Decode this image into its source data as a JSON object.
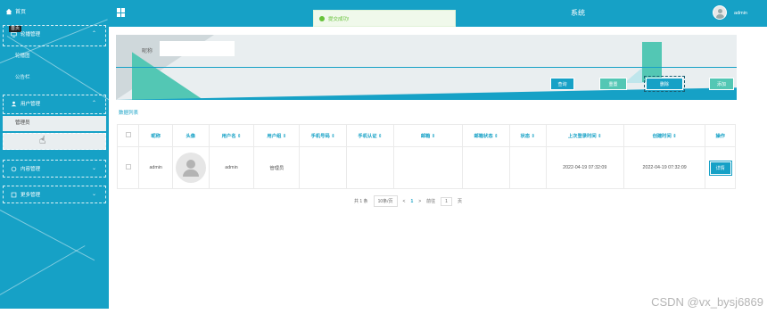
{
  "sidebar": {
    "home_label": "首页",
    "tooltip": "首页",
    "groups": [
      {
        "label": "轮播管理",
        "items": [
          "轮播图",
          "公告栏"
        ]
      },
      {
        "label": "用户管理",
        "items": [
          "管理员"
        ]
      },
      {
        "label": "内容管理",
        "items": []
      },
      {
        "label": "更多管理",
        "items": []
      }
    ]
  },
  "topbar": {
    "title_fragment": "系统",
    "user": "admin"
  },
  "toast": {
    "message": "提交成功!"
  },
  "search": {
    "label": "昵称",
    "value": ""
  },
  "toolbar": {
    "query_label": "查询",
    "reset_label": "重置",
    "delete_label": "删除",
    "add_label": "添加"
  },
  "table": {
    "title": "数据列表",
    "columns": [
      "昵称",
      "头像",
      "用户名 ⇕",
      "用户组 ⇕",
      "手机号码 ⇕",
      "手机认证 ⇕",
      "邮箱 ⇕",
      "邮箱状态 ⇕",
      "状态 ⇕",
      "上次登录时间 ⇕",
      "创建时间 ⇕",
      "操作"
    ],
    "rows": [
      {
        "nickname": "admin",
        "username": "admin",
        "group": "管理员",
        "phone": "",
        "phone_verified": "",
        "email": "",
        "email_status": "",
        "status": "",
        "last_login": "2022-04-19 07:32:09",
        "created": "2022-04-19 07:32:09",
        "action": "详情"
      }
    ]
  },
  "pagination": {
    "total": "共 1 条",
    "page_size": "10条/页",
    "prev": "<",
    "current": "1",
    "next": ">",
    "goto_prefix": "前往",
    "goto_value": "1",
    "goto_suffix": "页"
  },
  "watermark": "CSDN @vx_bysj6869",
  "colors": {
    "primary": "#16a1c6",
    "accent_teal": "#53c7b4",
    "panel_bg": "#e9eef0"
  }
}
